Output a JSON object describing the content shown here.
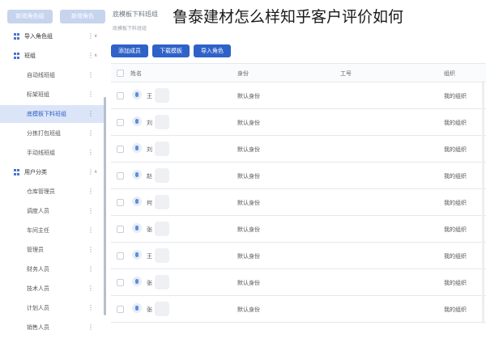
{
  "overlay": {
    "title": "鲁泰建材怎么样知乎客户评价如何"
  },
  "sidebar": {
    "top_buttons": [
      "新增角色组",
      "新增角色"
    ],
    "rows": [
      {
        "type": "group",
        "label": "导入角色组",
        "icon": "grid-icon",
        "dots": "⋮",
        "chev": "∨"
      },
      {
        "type": "group",
        "label": "班组",
        "icon": "grid-icon",
        "dots": "⋮",
        "chev": "∧"
      },
      {
        "type": "child",
        "label": "自动线班组",
        "dots": "⋮"
      },
      {
        "type": "child",
        "label": "标架班组",
        "dots": "⋮"
      },
      {
        "type": "child",
        "label": "底模板下料班组",
        "dots": "⋮",
        "active": true
      },
      {
        "type": "child",
        "label": "分拣打包班组",
        "dots": "⋮"
      },
      {
        "type": "child",
        "label": "手动线班组",
        "dots": "⋮"
      },
      {
        "type": "group",
        "label": "用户分类",
        "icon": "grid-icon",
        "dots": "⋮",
        "chev": "∧"
      },
      {
        "type": "child",
        "label": "仓库管理员",
        "dots": "⋮"
      },
      {
        "type": "child",
        "label": "调度人员",
        "dots": "⋮"
      },
      {
        "type": "child",
        "label": "车间主任",
        "dots": "⋮"
      },
      {
        "type": "child",
        "label": "管理员",
        "dots": "⋮"
      },
      {
        "type": "child",
        "label": "财务人员",
        "dots": "⋮"
      },
      {
        "type": "child",
        "label": "技术人员",
        "dots": "⋮"
      },
      {
        "type": "child",
        "label": "计划人员",
        "dots": "⋮"
      },
      {
        "type": "child",
        "label": "销售人员",
        "dots": "⋮"
      }
    ]
  },
  "main": {
    "title": "底模板下料班组",
    "subtitle": "底模板下料班组",
    "buttons": {
      "add_user": "添加成员",
      "download_template": "下载模板",
      "import_role": "导入角色"
    },
    "table": {
      "headers": {
        "name": "姓名",
        "role": "身份",
        "id": "工号",
        "org": "组织"
      },
      "rows": [
        {
          "name": "王",
          "role": "默认身份",
          "id": "",
          "org": "我的组织"
        },
        {
          "name": "刘",
          "role": "默认身份",
          "id": "",
          "org": "我的组织"
        },
        {
          "name": "刘",
          "role": "默认身份",
          "id": "",
          "org": "我的组织"
        },
        {
          "name": "赵",
          "role": "默认身份",
          "id": "",
          "org": "我的组织"
        },
        {
          "name": "何",
          "role": "默认身份",
          "id": "",
          "org": "我的组织"
        },
        {
          "name": "张",
          "role": "默认身份",
          "id": "",
          "org": "我的组织"
        },
        {
          "name": "王",
          "role": "默认身份",
          "id": "",
          "org": "我的组织"
        },
        {
          "name": "张",
          "role": "默认身份",
          "id": "",
          "org": "我的组织"
        },
        {
          "name": "张",
          "role": "默认身份",
          "id": "",
          "org": "我的组织"
        }
      ]
    }
  }
}
